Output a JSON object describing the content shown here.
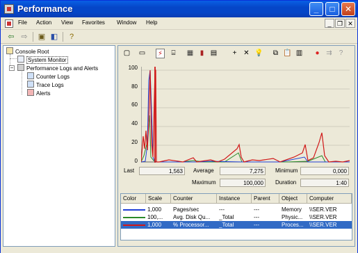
{
  "window": {
    "title": "Performance"
  },
  "title_buttons": [
    "minimize",
    "maximize",
    "close"
  ],
  "menu": [
    "File",
    "Action",
    "View",
    "Favorites",
    "Window",
    "Help"
  ],
  "tree": {
    "items": [
      {
        "label": "Console Root",
        "icon": "folder-icon"
      },
      {
        "label": "System Monitor",
        "icon": "system-monitor-icon"
      },
      {
        "label": "Performance Logs and Alerts",
        "icon": "logs-alerts-icon"
      },
      {
        "label": "Counter Logs",
        "icon": "counter-logs-icon"
      },
      {
        "label": "Trace Logs",
        "icon": "trace-logs-icon"
      },
      {
        "label": "Alerts",
        "icon": "alerts-icon"
      }
    ]
  },
  "graph": {
    "y_ticks": [
      "100",
      "80",
      "60",
      "40",
      "20",
      "0"
    ],
    "colors": {
      "pages": "#1f3fd6",
      "disk": "#2a8a2a",
      "processor": "#d01818"
    }
  },
  "stats": {
    "last_label": "Last",
    "last_value": "1,563",
    "average_label": "Average",
    "average_value": "7,275",
    "minimum_label": "Minimum",
    "minimum_value": "0,000",
    "maximum_label": "Maximum",
    "maximum_value": "100,000",
    "duration_label": "Duration",
    "duration_value": "1:40"
  },
  "counters": {
    "headers": [
      "Color",
      "Scale",
      "Counter",
      "Instance",
      "Parent",
      "Object",
      "Computer"
    ],
    "rows": [
      {
        "color": "#1f3fd6",
        "scale": "1,000",
        "counter": "Pages/sec",
        "instance": "---",
        "parent": "---",
        "object": "Memory",
        "computer": "\\\\SER.VER",
        "selected": false
      },
      {
        "color": "#2a8a2a",
        "scale": "100,...",
        "counter": "Avg. Disk Qu...",
        "instance": "_Total",
        "parent": "---",
        "object": "Physic...",
        "computer": "\\\\SER.VER",
        "selected": false
      },
      {
        "color": "#d01818",
        "scale": "1,000",
        "counter": "% Processor...",
        "instance": "_Total",
        "parent": "---",
        "object": "Proces...",
        "computer": "\\\\SER.VER",
        "selected": true
      }
    ]
  }
}
